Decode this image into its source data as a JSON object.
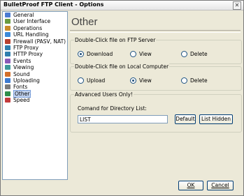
{
  "window": {
    "title": "BulletProof FTP Client - Options",
    "close_glyph": "✕"
  },
  "sidebar": {
    "items": [
      {
        "label": "General",
        "icon": "general-icon",
        "selected": false
      },
      {
        "label": "User Interface",
        "icon": "user-interface-icon",
        "selected": false
      },
      {
        "label": "Operations",
        "icon": "operations-icon",
        "selected": false
      },
      {
        "label": "URL Handling",
        "icon": "url-handling-icon",
        "selected": false
      },
      {
        "label": "Firewall (PASV, NAT)",
        "icon": "firewall-icon",
        "selected": false
      },
      {
        "label": "FTP Proxy",
        "icon": "ftp-proxy-icon",
        "selected": false
      },
      {
        "label": "HTTP Proxy",
        "icon": "http-proxy-icon",
        "selected": false
      },
      {
        "label": "Events",
        "icon": "events-icon",
        "selected": false
      },
      {
        "label": "Viewing",
        "icon": "viewing-icon",
        "selected": false
      },
      {
        "label": "Sound",
        "icon": "sound-icon",
        "selected": false
      },
      {
        "label": "Uploading",
        "icon": "uploading-icon",
        "selected": false
      },
      {
        "label": "Fonts",
        "icon": "fonts-icon",
        "selected": false
      },
      {
        "label": "Other",
        "icon": "other-icon",
        "selected": true
      },
      {
        "label": "Speed",
        "icon": "speed-icon",
        "selected": false
      }
    ]
  },
  "page": {
    "title": "Other"
  },
  "ftp_group": {
    "label": "Double-Click file on FTP Server",
    "options": [
      {
        "label": "Download",
        "checked": true
      },
      {
        "label": "View",
        "checked": false
      },
      {
        "label": "Delete",
        "checked": false
      }
    ]
  },
  "local_group": {
    "label": "Double-Click file on Local Computer",
    "options": [
      {
        "label": "Upload",
        "checked": false
      },
      {
        "label": "View",
        "checked": true
      },
      {
        "label": "Delete",
        "checked": false
      }
    ]
  },
  "advanced_group": {
    "label": "Advanced Users Only!",
    "field_label": "Comand for Directory List:",
    "field_value": "LIST",
    "default_label": "Default",
    "list_hidden_label": "List Hidden"
  },
  "footer": {
    "ok_label": "OK",
    "cancel_label": "Cancel"
  },
  "colors": {
    "selection": "#c1d2ee",
    "frame": "#ece9d8"
  }
}
